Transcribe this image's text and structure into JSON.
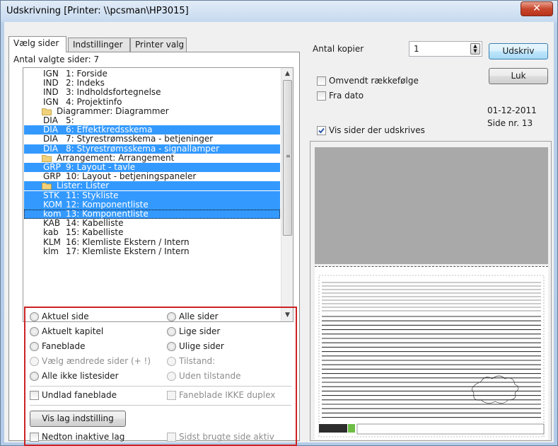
{
  "window": {
    "title": "Udskrivning [Printer: \\\\pcsman\\HP3015]",
    "close_glyph": "✕"
  },
  "tabs": [
    {
      "label": "Vælg sider",
      "active": true
    },
    {
      "label": "Indstillinger",
      "active": false
    },
    {
      "label": "Printer valg",
      "active": false
    }
  ],
  "selected_count_label": "Antal valgte sider: 7",
  "pages": [
    {
      "code": "IGN",
      "desc": "1: Forside",
      "selected": false
    },
    {
      "code": "IND",
      "desc": "2: Indeks",
      "selected": false
    },
    {
      "code": "IND",
      "desc": "3: Indholdsfortegnelse",
      "selected": false
    },
    {
      "code": "IGN",
      "desc": "4: Projektinfo",
      "selected": false
    },
    {
      "folder": true,
      "desc": "Diagrammer: Diagrammer",
      "selected": false
    },
    {
      "code": "DIA",
      "desc": "5:",
      "selected": false
    },
    {
      "code": "DIA",
      "desc": "6: Effektkredsskema",
      "selected": true
    },
    {
      "code": "DIA",
      "desc": "7: Styrestrømsskema - betjeninger",
      "selected": false
    },
    {
      "code": "DIA",
      "desc": "8: Styrestrømsskema - signallamper",
      "selected": true
    },
    {
      "folder": true,
      "desc": "Arrangement: Arrangement",
      "selected": false
    },
    {
      "code": "GRP",
      "desc": "9: Layout - tavle",
      "selected": true
    },
    {
      "code": "GRP",
      "desc": "10: Layout - betjeningspaneler",
      "selected": false
    },
    {
      "folder": true,
      "desc": "Lister: Lister",
      "selected": true
    },
    {
      "code": "STK",
      "desc": "11: Stykliste",
      "selected": true
    },
    {
      "code": "KOM",
      "desc": "12: Komponentliste",
      "selected": true
    },
    {
      "code": "kom",
      "desc": "13: Komponentliste",
      "selected": true,
      "focused": true
    },
    {
      "code": "KAB",
      "desc": "14: Kabelliste",
      "selected": false
    },
    {
      "code": "kab",
      "desc": "15: Kabelliste",
      "selected": false
    },
    {
      "code": "KLM",
      "desc": "16: Klemliste Ekstern / Intern",
      "selected": false
    },
    {
      "code": "klm",
      "desc": "17: Klemliste Ekstern / Intern",
      "selected": false
    }
  ],
  "options": {
    "aktuel_side": "Aktuel side",
    "alle_sider": "Alle sider",
    "aktuelt_kapitel": "Aktuelt kapitel",
    "lige_sider": "Lige sider",
    "faneblade": "Faneblade",
    "ulige_sider": "Ulige sider",
    "vaelg_aendrede": "Vælg ændrede sider (+ !)",
    "tilstand": "Tilstand:",
    "alle_ikke_liste": "Alle ikke listesider",
    "uden_tilstande": "Uden tilstande",
    "undlad_faneblade": "Undlad faneblade",
    "faneblade_duplex": "Faneblade IKKE duplex",
    "vis_lag_button": "Vis lag indstilling",
    "nedton": "Nedton inaktive lag",
    "sidst_brugte": "Sidst brugte side aktiv"
  },
  "right_panel": {
    "copies_label": "Antal kopier",
    "copies_value": "1",
    "print_button": "Udskriv",
    "close_button": "Luk",
    "reverse_order": "Omvendt rækkefølge",
    "from_date": "Fra dato",
    "show_pages": "Vis sider der udskrives",
    "show_pages_checked": true,
    "date": "01-12-2011",
    "page_no": "Side nr. 13"
  },
  "colors": {
    "selection": "#3399ff",
    "highlight_box": "#cc2222",
    "preview_gray": "#a9a9a9"
  }
}
